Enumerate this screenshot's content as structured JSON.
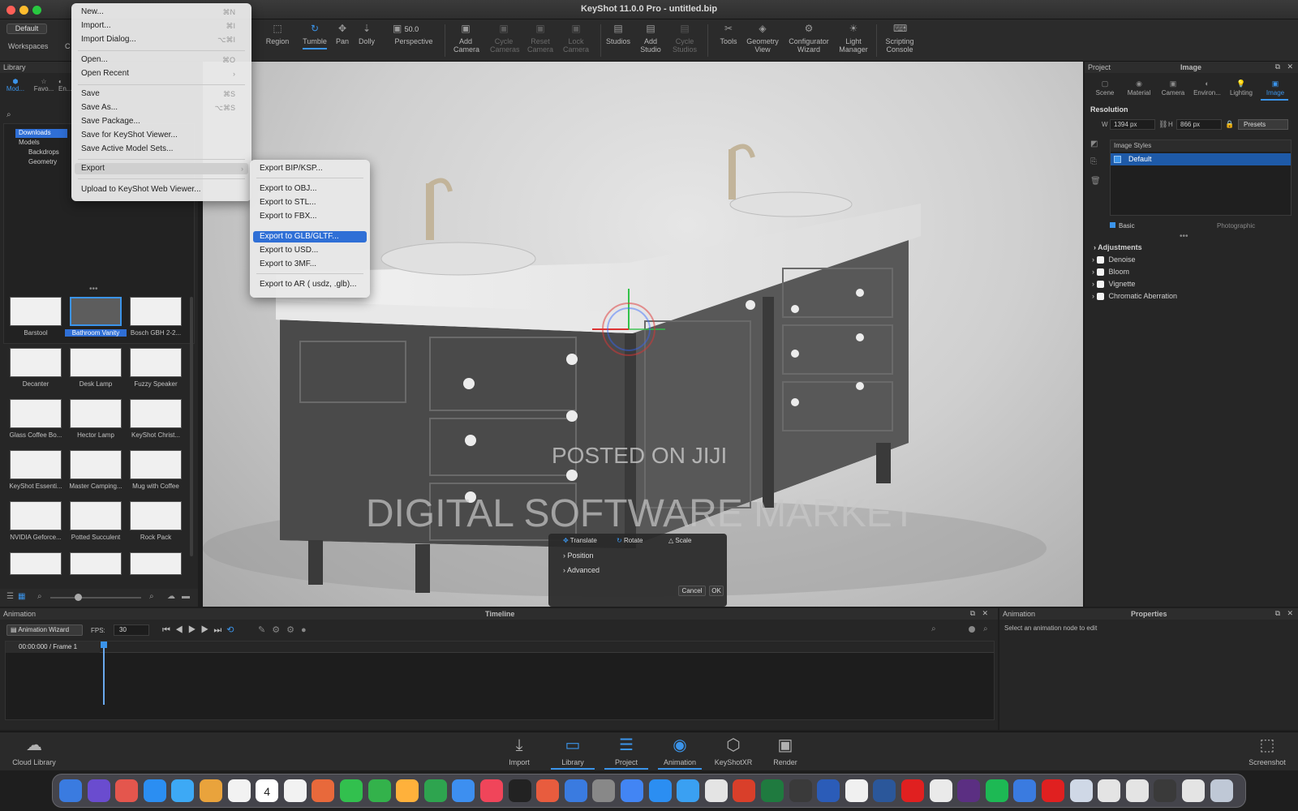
{
  "window": {
    "title": "KeyShot 11.0.0 Pro  - untitled.bip"
  },
  "toolbar": {
    "workspace_value": "Default",
    "workspaces_label": "Workspaces",
    "items": [
      {
        "label": "Region",
        "icon": "region-icon"
      },
      {
        "label": "Tumble",
        "icon": "tumble-icon",
        "active": true
      },
      {
        "label": "Pan",
        "icon": "pan-icon"
      },
      {
        "label": "Dolly",
        "icon": "dolly-icon"
      },
      {
        "label": "Perspective",
        "icon": "perspective-icon"
      },
      {
        "label": "Add Camera",
        "icon": "add-camera-icon"
      },
      {
        "label": "Cycle Cameras",
        "icon": "cycle-cameras-icon",
        "disabled": true
      },
      {
        "label": "Reset Camera",
        "icon": "reset-camera-icon",
        "disabled": true
      },
      {
        "label": "Lock Camera",
        "icon": "lock-camera-icon",
        "disabled": true
      },
      {
        "label": "Studios",
        "icon": "studios-icon"
      },
      {
        "label": "Add Studio",
        "icon": "add-studio-icon"
      },
      {
        "label": "Cycle Studios",
        "icon": "cycle-studios-icon",
        "disabled": true
      },
      {
        "label": "Tools",
        "icon": "tools-icon"
      },
      {
        "label": "Geometry View",
        "icon": "geometry-view-icon"
      },
      {
        "label": "Configurator Wizard",
        "icon": "configurator-icon"
      },
      {
        "label": "Light Manager",
        "icon": "light-manager-icon"
      },
      {
        "label": "Scripting Console",
        "icon": "scripting-icon"
      }
    ],
    "perspective_value": "50.0"
  },
  "file_menu": {
    "items": [
      {
        "label": "New...",
        "shortcut": "⌘N"
      },
      {
        "label": "Import...",
        "shortcut": "⌘I"
      },
      {
        "label": "Import Dialog...",
        "shortcut": "⌥⌘I"
      },
      {
        "label": "Open...",
        "shortcut": "⌘O"
      },
      {
        "label": "Open Recent",
        "shortcut": "›"
      },
      {
        "label": "Save",
        "shortcut": "⌘S"
      },
      {
        "label": "Save As...",
        "shortcut": "⌥⌘S"
      },
      {
        "label": "Save Package...",
        "shortcut": ""
      },
      {
        "label": "Save for KeyShot Viewer...",
        "shortcut": ""
      },
      {
        "label": "Save Active Model Sets...",
        "shortcut": ""
      },
      {
        "label": "Export",
        "shortcut": "›"
      },
      {
        "label": "Upload to KeyShot Web Viewer...",
        "shortcut": ""
      }
    ]
  },
  "export_submenu": {
    "items": [
      {
        "label": "Export BIP/KSP..."
      },
      {
        "label": "Export to OBJ..."
      },
      {
        "label": "Export to STL..."
      },
      {
        "label": "Export to FBX..."
      },
      {
        "label": "Export to GLB/GLTF...",
        "selected": true
      },
      {
        "label": "Export to USD..."
      },
      {
        "label": "Export to 3MF..."
      },
      {
        "label": "Export to AR ( usdz, .glb)..."
      }
    ]
  },
  "library": {
    "title": "Library",
    "tabs": [
      "Mod...",
      "Favo...",
      "En..."
    ],
    "tree": [
      "Downloads",
      "Models",
      "Backdrops",
      "Geometry"
    ],
    "models": [
      "Barstool",
      "Bathroom Vanity",
      "Bosch GBH 2-2...",
      "Decanter",
      "Desk Lamp",
      "Fuzzy Speaker",
      "Glass Coffee Bo...",
      "Hector Lamp",
      "KeyShot Christ...",
      "KeyShot Essenti...",
      "Master Camping...",
      "Mug with Coffee",
      "NVIDIA Geforce...",
      "Potted Succulent",
      "Rock Pack"
    ]
  },
  "project": {
    "title": "Project",
    "subtitle": "Image",
    "tabs": [
      "Scene",
      "Material",
      "Camera",
      "Environ...",
      "Lighting",
      "Image"
    ],
    "resolution_label": "Resolution",
    "width": "1394 px",
    "height": "866 px",
    "presets": "Presets",
    "image_styles_label": "Image Styles",
    "style_default": "Default",
    "basic": "Basic",
    "photographic": "Photographic",
    "adjustments_label": "Adjustments",
    "adjustments": [
      "Denoise",
      "Bloom",
      "Vignette",
      "Chromatic Aberration"
    ]
  },
  "move_tool": {
    "tabs": [
      "Translate",
      "Rotate",
      "Scale"
    ],
    "sections": [
      "Position",
      "Advanced"
    ],
    "cancel": "Cancel",
    "ok": "OK"
  },
  "timeline": {
    "panel_title": "Animation",
    "title": "Timeline",
    "wizard": "Animation Wizard",
    "fps_label": "FPS:",
    "fps_value": "30",
    "time": "00:00:000 / Frame 1"
  },
  "animation_props": {
    "title": "Animation",
    "props": "Properties",
    "hint": "Select an animation node to edit"
  },
  "bottom": {
    "cloud": "Cloud Library",
    "items": [
      "Import",
      "Library",
      "Project",
      "Animation",
      "KeyShotXR",
      "Render"
    ],
    "screenshot": "Screenshot"
  },
  "watermark": {
    "line1": "POSTED ON JIJI",
    "line2": "DIGITAL SOFTWARE MARKET"
  },
  "dock_calendar_day": "4",
  "colors": {
    "accent": "#3b94ea",
    "menu_highlight": "#2f6fd6"
  }
}
